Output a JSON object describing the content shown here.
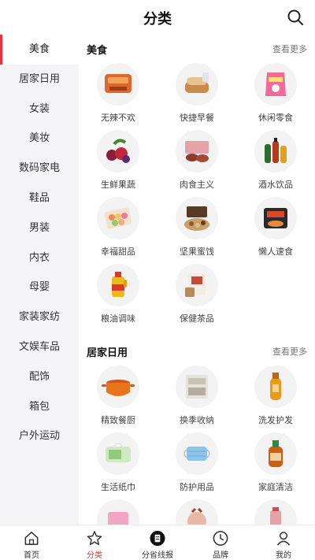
{
  "header": {
    "title": "分类",
    "search_icon": "search-icon"
  },
  "sidebar": {
    "items": [
      {
        "label": "美食",
        "active": true
      },
      {
        "label": "居家日用"
      },
      {
        "label": "女装"
      },
      {
        "label": "美妆"
      },
      {
        "label": "数码家电"
      },
      {
        "label": "鞋品"
      },
      {
        "label": "男装"
      },
      {
        "label": "内衣"
      },
      {
        "label": "母婴"
      },
      {
        "label": "家装家纺"
      },
      {
        "label": "文娱车品"
      },
      {
        "label": "配饰"
      },
      {
        "label": "箱包"
      },
      {
        "label": "户外运动"
      }
    ]
  },
  "sections": [
    {
      "title": "美食",
      "more": "查看更多",
      "items": [
        {
          "label": "无辣不欢",
          "icon": "spicy-meat-icon"
        },
        {
          "label": "快捷早餐",
          "icon": "bread-icon"
        },
        {
          "label": "休闲零食",
          "icon": "snack-bag-icon"
        },
        {
          "label": "生鲜果蔬",
          "icon": "fruit-icon"
        },
        {
          "label": "肉食主义",
          "icon": "meat-box-icon"
        },
        {
          "label": "酒水饮品",
          "icon": "bottles-icon"
        },
        {
          "label": "幸福甜品",
          "icon": "macaron-icon"
        },
        {
          "label": "坚果蜜饯",
          "icon": "nuts-gift-icon"
        },
        {
          "label": "懒人速食",
          "icon": "instant-noodle-icon"
        },
        {
          "label": "粮油调味",
          "icon": "oil-bottle-icon"
        },
        {
          "label": "保健茶品",
          "icon": "tea-box-icon"
        }
      ]
    },
    {
      "title": "居家日用",
      "more": "查看更多",
      "items": [
        {
          "label": "精致餐厨",
          "icon": "pot-icon"
        },
        {
          "label": "换季收纳",
          "icon": "storage-box-icon"
        },
        {
          "label": "洗发护发",
          "icon": "shampoo-icon"
        },
        {
          "label": "生活纸巾",
          "icon": "tissue-icon"
        },
        {
          "label": "防护用品",
          "icon": "mask-icon"
        },
        {
          "label": "家庭清洁",
          "icon": "cleaner-bottle-icon"
        },
        {
          "label": "",
          "icon": "product-icon"
        },
        {
          "label": "",
          "icon": "product-icon"
        },
        {
          "label": "",
          "icon": "product-icon"
        }
      ]
    }
  ],
  "tabbar": [
    {
      "label": "首页",
      "icon": "home-icon"
    },
    {
      "label": "分类",
      "icon": "star-icon",
      "active": true
    },
    {
      "label": "分省线报",
      "icon": "document-icon"
    },
    {
      "label": "品牌",
      "icon": "clock-icon"
    },
    {
      "label": "我的",
      "icon": "user-icon"
    }
  ],
  "colors": {
    "accent": "#e8303d",
    "sidebar_bg": "#f5f5f7"
  }
}
